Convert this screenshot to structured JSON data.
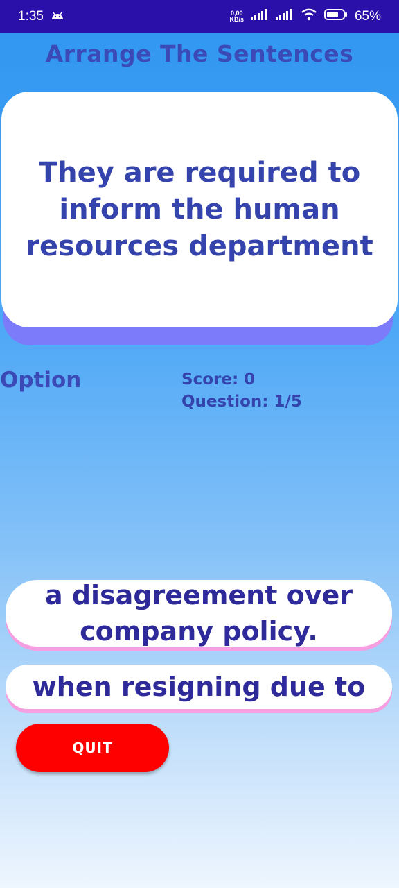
{
  "status_bar": {
    "time": "1:35",
    "net_speed_top": "0,00",
    "net_speed_unit": "KB/s",
    "battery": "65%"
  },
  "page": {
    "title": "Arrange The Sentences"
  },
  "question": {
    "text": "They are required to inform the human resources department"
  },
  "options_section": {
    "label": "Option"
  },
  "stats": {
    "score": "Score: 0",
    "question": "Question: 1/5"
  },
  "options": [
    {
      "text": "a disagreement over company policy."
    },
    {
      "text": "when resigning due to"
    }
  ],
  "quit": {
    "label": "QUIT"
  },
  "colors": {
    "status_bar": "#2a0fa8",
    "title": "#3b4ab7",
    "card_shadow": "#7c7cfb",
    "quit": "#ff0000",
    "option_shadow": "#f59ee0"
  }
}
